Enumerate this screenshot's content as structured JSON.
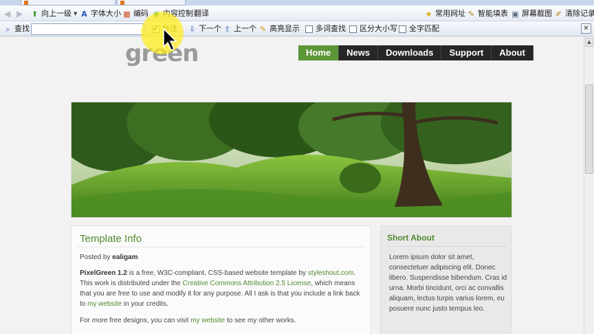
{
  "browser": {
    "toolbar": {
      "up_one_level": "向上一级",
      "font_size": "字体大小",
      "encoding": "编码",
      "content_control": "内容控制",
      "translate": "翻译",
      "common_sites": "常用网址",
      "smart_fill": "智能填表",
      "screenshot": "屏幕截图",
      "clear_records": "清除记录"
    },
    "findbar": {
      "label": "查找",
      "input_value": "",
      "mark_label": "标注",
      "mark_checked": true,
      "next_label": "下一个",
      "prev_label": "上一个",
      "highlight_all_label": "高亮显示",
      "multi_word_label": "多词查找",
      "case_sensitive_label": "区分大小写",
      "full_width_label": "全字匹配"
    }
  },
  "site": {
    "logo_text": "green",
    "nav": [
      {
        "label": "Home",
        "active": true
      },
      {
        "label": "News",
        "active": false
      },
      {
        "label": "Downloads",
        "active": false
      },
      {
        "label": "Support",
        "active": false
      },
      {
        "label": "About",
        "active": false
      }
    ],
    "main": {
      "title": "Template Info",
      "posted_by_prefix": "Posted by",
      "posted_by_author": "ealigam",
      "p1": {
        "product": "PixelGreen 1.2",
        "t1": "is a free, W3C-compliant, CSS-based website template by",
        "site_link": "styleshout.com",
        "t2": ". This work is distributed under the",
        "license_link": "Creative Commons Attribution 2.5 License",
        "t3": ", which means that you are free to use and modify it for any purpose. All I ask is that you include a link back to",
        "website_link": "my website",
        "t4": "in your credits."
      },
      "p2": {
        "t1": "For more free designs, you can visit",
        "website_link": "my website",
        "t2": "to see my other works."
      }
    },
    "sidebar": {
      "title": "Short About",
      "body": "Lorem ipsum dolor sit amet, consectetuer adipiscing elit. Donec libero. Suspendisse bibendum. Cras id urna. Morbi tincidunt, orci ac convallis aliquam, lectus turpis varius lorem, eu posuere nunc justo tempus leo."
    }
  },
  "colors": {
    "accent_green": "#4f8a2e",
    "nav_active": "#5b9637",
    "nav_bg": "#262626",
    "highlight": "#ffec1e"
  }
}
